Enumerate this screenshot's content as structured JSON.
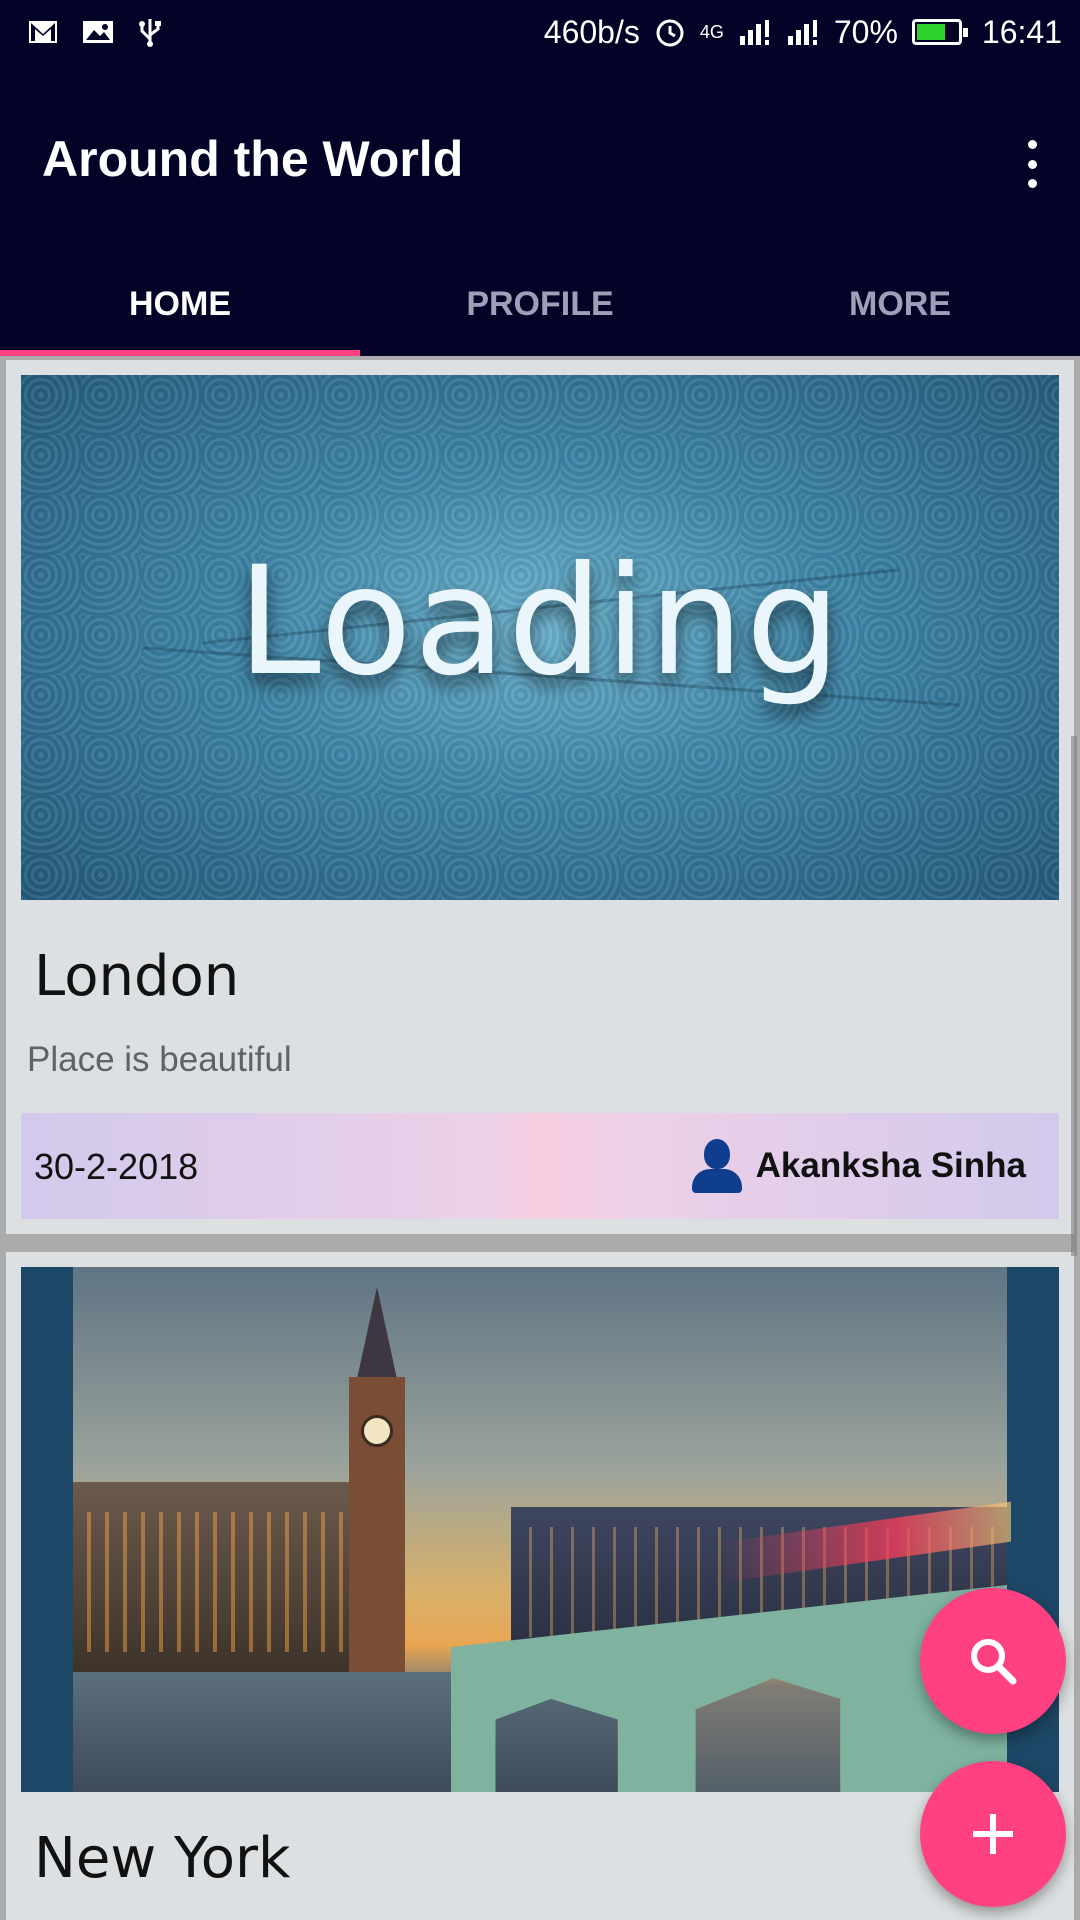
{
  "status_bar": {
    "left_icons": [
      "gmail-icon",
      "image-icon",
      "usb-icon"
    ],
    "speed": "460b/s",
    "network_label": "4G",
    "battery_percent": "70%",
    "battery_level": 0.7,
    "time": "16:41"
  },
  "app_bar": {
    "title": "Around the World",
    "overflow_icon": "more-vert-icon"
  },
  "tabs": [
    {
      "label": "HOME",
      "active": true
    },
    {
      "label": "PROFILE",
      "active": false
    },
    {
      "label": "MORE",
      "active": false
    }
  ],
  "accent_color": "#ff4081",
  "primary_color": "#020326",
  "cards": [
    {
      "image_text": "Loading",
      "title": "London",
      "description": "Place is beautiful",
      "date": "30-2-2018",
      "author": "Akanksha Sinha"
    },
    {
      "title": "New York"
    }
  ],
  "fabs": [
    {
      "icon": "search-icon"
    },
    {
      "icon": "plus-icon"
    }
  ]
}
